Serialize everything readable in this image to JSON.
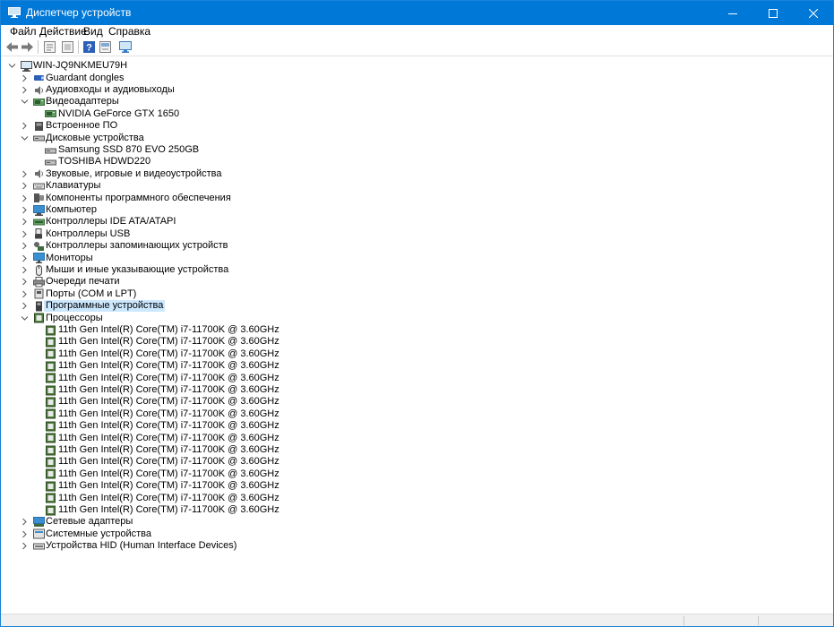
{
  "window": {
    "title": "Диспетчер устройств",
    "accent_color": "#0078d7"
  },
  "menu": [
    {
      "label": "Файл"
    },
    {
      "label": "Действие"
    },
    {
      "label": "Вид"
    },
    {
      "label": "Справка"
    }
  ],
  "toolbar": {
    "buttons": [
      "back-arrow-icon",
      "forward-arrow-icon",
      "properties-icon",
      "show-hidden-icon",
      "help-icon",
      "update-driver-icon",
      "scan-hardware-icon"
    ]
  },
  "tree": {
    "root": "WIN-JQ9NKMEU79H",
    "nodes": [
      {
        "label": "Guardant dongles",
        "icon": "usb-key-icon",
        "level": 1,
        "expanded": false
      },
      {
        "label": "Аудиовходы и аудиовыходы",
        "icon": "speaker-icon",
        "level": 1,
        "expanded": false
      },
      {
        "label": "Видеоадаптеры",
        "icon": "display-adapter-icon",
        "level": 1,
        "expanded": true
      },
      {
        "label": "NVIDIA GeForce GTX 1650",
        "icon": "display-adapter-icon",
        "level": 2
      },
      {
        "label": "Встроенное ПО",
        "icon": "firmware-icon",
        "level": 1,
        "expanded": false
      },
      {
        "label": "Дисковые устройства",
        "icon": "disk-drive-icon",
        "level": 1,
        "expanded": true
      },
      {
        "label": "Samsung SSD 870 EVO 250GB",
        "icon": "disk-drive-icon",
        "level": 2
      },
      {
        "label": "TOSHIBA HDWD220",
        "icon": "disk-drive-icon",
        "level": 2
      },
      {
        "label": "Звуковые, игровые и видеоустройства",
        "icon": "speaker-icon",
        "level": 1,
        "expanded": false
      },
      {
        "label": "Клавиатуры",
        "icon": "keyboard-icon",
        "level": 1,
        "expanded": false
      },
      {
        "label": "Компоненты программного обеспечения",
        "icon": "software-component-icon",
        "level": 1,
        "expanded": false
      },
      {
        "label": "Компьютер",
        "icon": "computer-icon",
        "level": 1,
        "expanded": false
      },
      {
        "label": "Контроллеры IDE ATA/ATAPI",
        "icon": "ide-controller-icon",
        "level": 1,
        "expanded": false
      },
      {
        "label": "Контроллеры USB",
        "icon": "usb-icon",
        "level": 1,
        "expanded": false
      },
      {
        "label": "Контроллеры запоминающих устройств",
        "icon": "storage-controller-icon",
        "level": 1,
        "expanded": false
      },
      {
        "label": "Мониторы",
        "icon": "monitor-icon",
        "level": 1,
        "expanded": false
      },
      {
        "label": "Мыши и иные указывающие устройства",
        "icon": "mouse-icon",
        "level": 1,
        "expanded": false
      },
      {
        "label": "Очереди печати",
        "icon": "printer-icon",
        "level": 1,
        "expanded": false
      },
      {
        "label": "Порты (COM и LPT)",
        "icon": "port-icon",
        "level": 1,
        "expanded": false
      },
      {
        "label": "Программные устройства",
        "icon": "software-device-icon",
        "level": 1,
        "expanded": false,
        "selected": true
      },
      {
        "label": "Процессоры",
        "icon": "processor-icon",
        "level": 1,
        "expanded": true
      },
      {
        "label": "11th Gen Intel(R) Core(TM) i7-11700K @ 3.60GHz",
        "icon": "processor-icon",
        "level": 2
      },
      {
        "label": "11th Gen Intel(R) Core(TM) i7-11700K @ 3.60GHz",
        "icon": "processor-icon",
        "level": 2
      },
      {
        "label": "11th Gen Intel(R) Core(TM) i7-11700K @ 3.60GHz",
        "icon": "processor-icon",
        "level": 2
      },
      {
        "label": "11th Gen Intel(R) Core(TM) i7-11700K @ 3.60GHz",
        "icon": "processor-icon",
        "level": 2
      },
      {
        "label": "11th Gen Intel(R) Core(TM) i7-11700K @ 3.60GHz",
        "icon": "processor-icon",
        "level": 2
      },
      {
        "label": "11th Gen Intel(R) Core(TM) i7-11700K @ 3.60GHz",
        "icon": "processor-icon",
        "level": 2
      },
      {
        "label": "11th Gen Intel(R) Core(TM) i7-11700K @ 3.60GHz",
        "icon": "processor-icon",
        "level": 2
      },
      {
        "label": "11th Gen Intel(R) Core(TM) i7-11700K @ 3.60GHz",
        "icon": "processor-icon",
        "level": 2
      },
      {
        "label": "11th Gen Intel(R) Core(TM) i7-11700K @ 3.60GHz",
        "icon": "processor-icon",
        "level": 2
      },
      {
        "label": "11th Gen Intel(R) Core(TM) i7-11700K @ 3.60GHz",
        "icon": "processor-icon",
        "level": 2
      },
      {
        "label": "11th Gen Intel(R) Core(TM) i7-11700K @ 3.60GHz",
        "icon": "processor-icon",
        "level": 2
      },
      {
        "label": "11th Gen Intel(R) Core(TM) i7-11700K @ 3.60GHz",
        "icon": "processor-icon",
        "level": 2
      },
      {
        "label": "11th Gen Intel(R) Core(TM) i7-11700K @ 3.60GHz",
        "icon": "processor-icon",
        "level": 2
      },
      {
        "label": "11th Gen Intel(R) Core(TM) i7-11700K @ 3.60GHz",
        "icon": "processor-icon",
        "level": 2
      },
      {
        "label": "11th Gen Intel(R) Core(TM) i7-11700K @ 3.60GHz",
        "icon": "processor-icon",
        "level": 2
      },
      {
        "label": "11th Gen Intel(R) Core(TM) i7-11700K @ 3.60GHz",
        "icon": "processor-icon",
        "level": 2
      },
      {
        "label": "Сетевые адаптеры",
        "icon": "network-adapter-icon",
        "level": 1,
        "expanded": false
      },
      {
        "label": "Системные устройства",
        "icon": "system-device-icon",
        "level": 1,
        "expanded": false
      },
      {
        "label": "Устройства HID (Human Interface Devices)",
        "icon": "hid-icon",
        "level": 1,
        "expanded": false
      }
    ]
  }
}
